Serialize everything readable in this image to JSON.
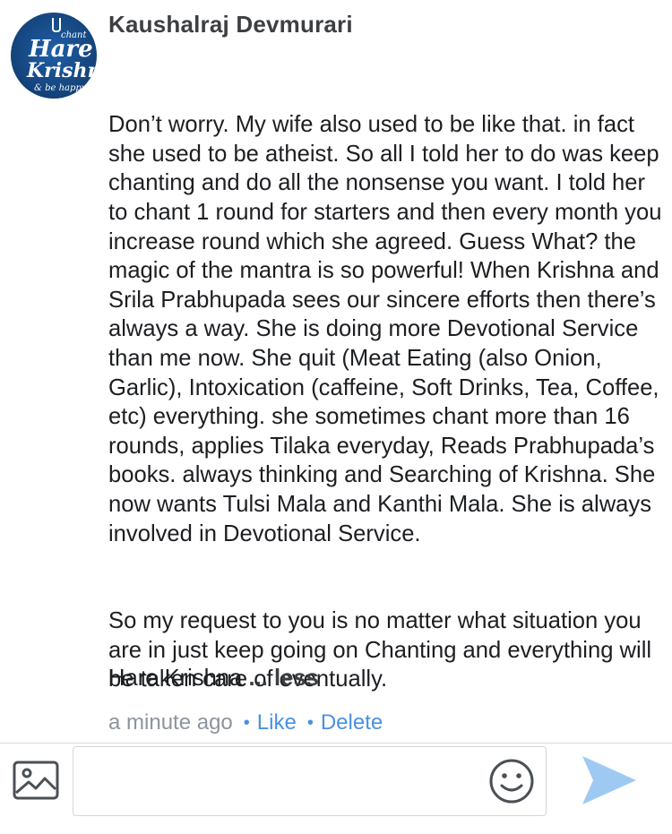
{
  "comment": {
    "author": "Kaushalraj Devmurari",
    "avatar_text": {
      "line1": "chant",
      "line2": "Hare",
      "line3": "Krishna",
      "line4": "& be happy"
    },
    "paragraph1": "Don’t worry. My wife also used to be like that. in fact she used to be atheist. So all I told her to do was keep chanting and do all the nonsense you want. I told her to chant 1 round for starters and then every month you increase round which she agreed. Guess What? the magic of the mantra is so powerful! When Krishna and Srila Prabhupada sees our sincere efforts then there’s always a way. She is doing more Devotional Service than me now. She quit (Meat Eating (also Onion, Garlic), Intoxication (caffeine, Soft Drinks, Tea, Coffee, etc) everything. she sometimes chant more than 16 rounds, applies Tilaka everyday, Reads Prabhupada’s books. always thinking and Searching of Krishna. She now wants Tulsi Mala and Kanthi Mala. She is always involved in Devotional Service.",
    "paragraph2": "So my request to you is no matter what situation you are in just keep going on Chanting and everything will be taken care of eventually.",
    "closing": "Hare Krishna",
    "ellipsis": "...",
    "less_label": "less",
    "timestamp": "a minute ago",
    "like_label": "Like",
    "delete_label": "Delete"
  },
  "composer": {
    "placeholder": "",
    "photo_icon": "photo-icon",
    "emoji_icon": "smiley-icon",
    "send_icon": "send-icon"
  },
  "colors": {
    "link": "#4a90e2",
    "meta": "#8d949e",
    "send": "#9ec9f3"
  }
}
